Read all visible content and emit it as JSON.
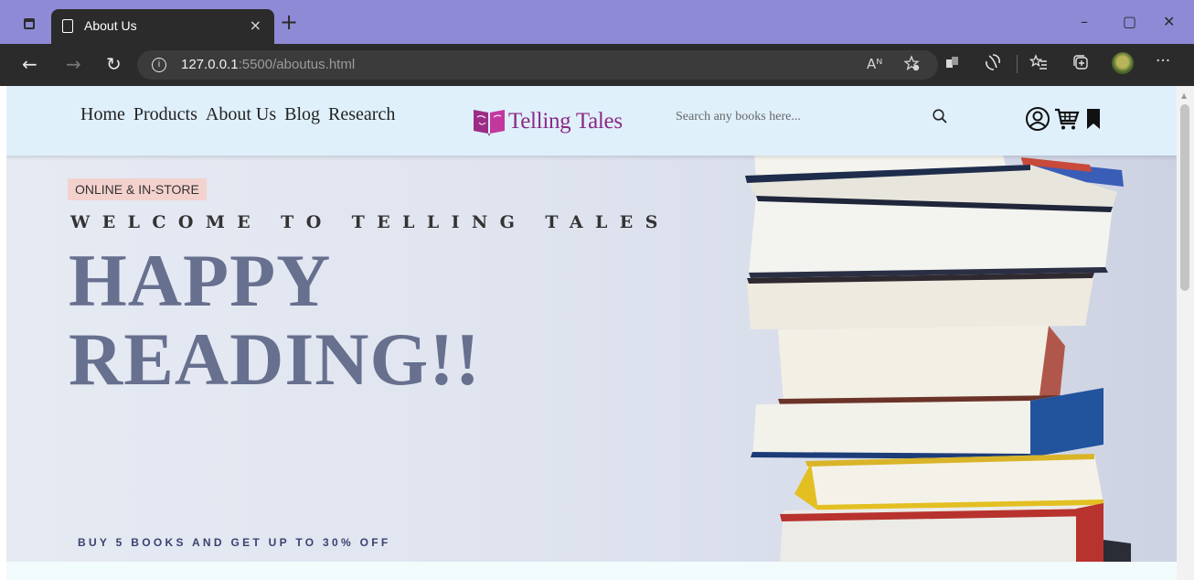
{
  "browser": {
    "tab_title": "About Us",
    "tab_close": "×",
    "new_tab": "+",
    "window_controls": {
      "minimize": "–",
      "restore": "▢",
      "close": "✕"
    },
    "nav": {
      "back": "←",
      "forward": "→",
      "reload": "↻"
    },
    "info_icon": "i",
    "url_host": "127.0.0.1",
    "url_rest": ":5500/aboutus.html",
    "toolbar_icons": [
      "read-aloud-icon",
      "favorite-add-icon",
      "extensions-icon",
      "copilot-icon",
      "favorites-icon",
      "collections-icon",
      "profile-icon",
      "more-icon"
    ],
    "read_aloud": "Aᴺ",
    "more": "···"
  },
  "header": {
    "nav_items": [
      {
        "label": "Home"
      },
      {
        "label": "Products"
      },
      {
        "label": "About Us"
      },
      {
        "label": "Blog"
      },
      {
        "label": "Research"
      }
    ],
    "logo_text": "Telling Tales",
    "search_placeholder": "Search any books here..."
  },
  "hero": {
    "badge": "ONLINE & IN-STORE",
    "welcome": "WELCOME TO TELLING TALES",
    "headline_line1": "HAPPY",
    "headline_line2": "READING!!",
    "promo": "BUY 5 BOOKS AND GET UP TO 30% OFF"
  },
  "colors": {
    "tabbar": "#8f8ad6",
    "addressbar": "#2b2b2b",
    "header_bg": "#dff0fb",
    "logo": "#8b2a86",
    "headline": "#68708f",
    "badge_bg": "#f3d2ce",
    "promo": "#3a4270"
  }
}
